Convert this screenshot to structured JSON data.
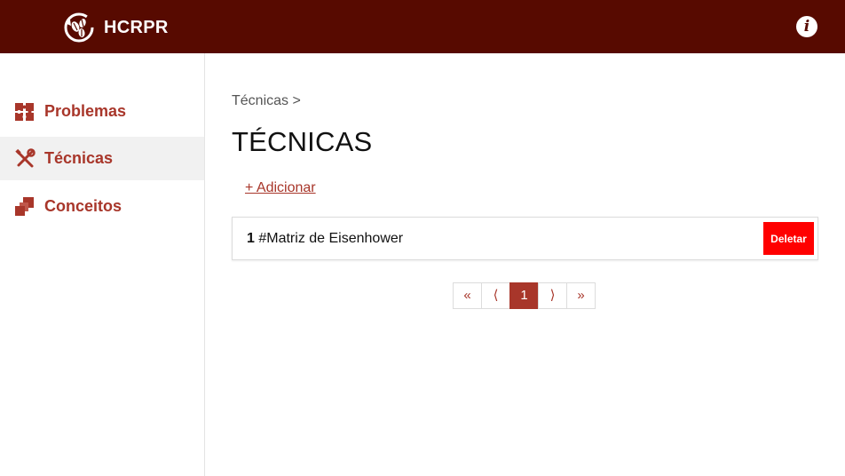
{
  "header": {
    "app_title": "HCRPR",
    "info_icon_glyph": "i",
    "logo_icon": "coffee-beans-cycle-icon",
    "background_color": "#570a00"
  },
  "sidebar": {
    "items": [
      {
        "label": "Problemas",
        "icon": "puzzle-pieces-icon",
        "active": false
      },
      {
        "label": "Técnicas",
        "icon": "tools-icon",
        "active": true
      },
      {
        "label": "Conceitos",
        "icon": "stacked-squares-icon",
        "active": false
      }
    ],
    "accent_color": "#a8362a"
  },
  "main": {
    "breadcrumb": "Técnicas >",
    "title": "TÉCNICAS",
    "add_link": "+ Adicionar",
    "items": [
      {
        "number": "1",
        "name": "#Matriz de Eisenhower",
        "delete_label": "Deletar"
      }
    ],
    "delete_color": "#ff0000"
  },
  "pagination": {
    "first": "«",
    "prev": "⟨",
    "current": "1",
    "next": "⟩",
    "last": "»"
  }
}
